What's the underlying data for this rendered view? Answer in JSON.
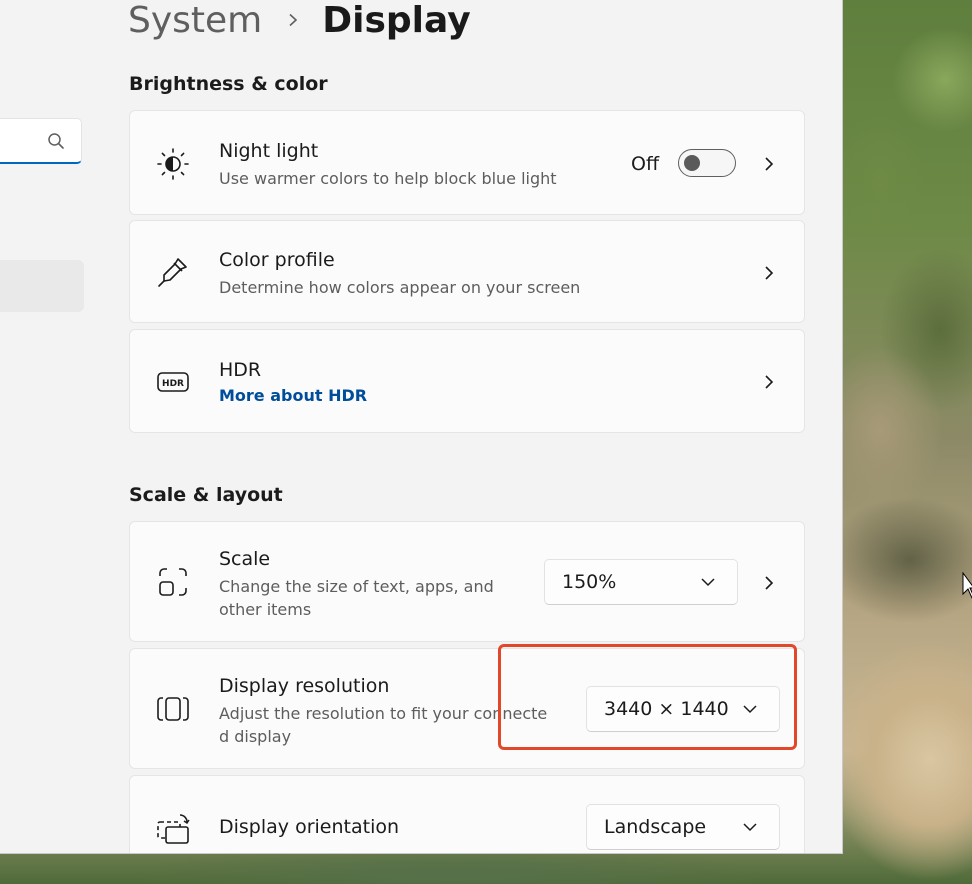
{
  "header": {
    "breadcrumb_parent": "System",
    "breadcrumb_current": "Display"
  },
  "sections": {
    "brightness": "Brightness & color",
    "scale_layout": "Scale & layout"
  },
  "night_light": {
    "title": "Night light",
    "description": "Use warmer colors to help block blue light",
    "state": "Off",
    "enabled": false
  },
  "color_profile": {
    "title": "Color profile",
    "description": "Determine how colors appear on your screen"
  },
  "hdr": {
    "title": "HDR",
    "link": "More about HDR"
  },
  "scale": {
    "title": "Scale",
    "description_line1": "Change the size of text, apps, and",
    "description_line2": "other items",
    "value": "150%"
  },
  "display_resolution": {
    "title": "Display resolution",
    "description_line1": "Adjust the resolution to fit your connecte",
    "description_line2": "d display",
    "value": "3440 × 1440"
  },
  "display_orientation": {
    "title": "Display orientation",
    "value": "Landscape"
  },
  "colors": {
    "accent": "#0067c0",
    "link": "#004e9a",
    "highlight": "#e2472a"
  }
}
